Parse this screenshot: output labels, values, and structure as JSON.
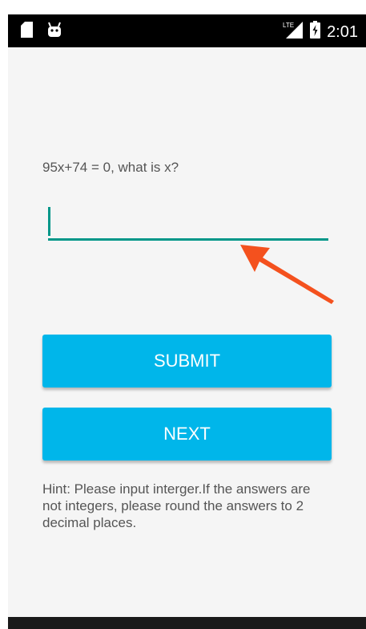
{
  "status_bar": {
    "network": "LTE",
    "time": "2:01",
    "icons": [
      "sd-card-icon",
      "android-icon",
      "lte-signal-icon",
      "battery-charging-icon"
    ]
  },
  "question": {
    "text": "95x+74 = 0, what is x?"
  },
  "answer_input": {
    "value": "",
    "placeholder": ""
  },
  "buttons": {
    "submit": "SUBMIT",
    "next": "NEXT"
  },
  "hint": {
    "text": "Hint: Please input interger.If the answers are not integers, please round the answers to 2 decimal places."
  },
  "colors": {
    "accent": "#009688",
    "button": "#00b6ea",
    "annotation_arrow": "#f4511e"
  }
}
